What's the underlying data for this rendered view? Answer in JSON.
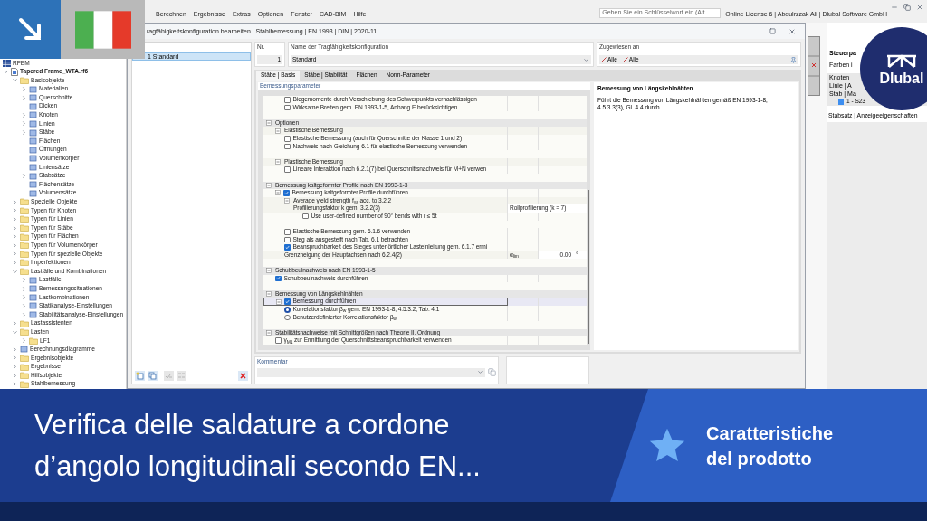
{
  "menu": {
    "items": [
      "Berechnen",
      "Ergebnisse",
      "Extras",
      "Optionen",
      "Fenster",
      "CAD-BIM",
      "Hilfe"
    ]
  },
  "search": {
    "placeholder": "Geben Sie ein Schlüsselwort ein (Alt..."
  },
  "license": "Online License 6 | Abdulrzzak Ali | Dlubal Software GmbH",
  "navigator": {
    "items": [
      {
        "label": "RFEM",
        "kind": "root"
      },
      {
        "label": "Tapered Frame_WTA.rf6",
        "kind": "file",
        "expanded": true,
        "children": [
          {
            "label": "Basisobjekte",
            "kind": "folder",
            "expanded": true,
            "children": [
              {
                "label": "Materialien",
                "kind": "item",
                "expanded": false
              },
              {
                "label": "Querschnitte",
                "kind": "item",
                "expanded": false
              },
              {
                "label": "Dicken",
                "kind": "item"
              },
              {
                "label": "Knoten",
                "kind": "item",
                "expanded": false
              },
              {
                "label": "Linien",
                "kind": "item",
                "expanded": false
              },
              {
                "label": "Stäbe",
                "kind": "item",
                "expanded": false
              },
              {
                "label": "Flächen",
                "kind": "item"
              },
              {
                "label": "Öffnungen",
                "kind": "item"
              },
              {
                "label": "Volumenkörper",
                "kind": "item"
              },
              {
                "label": "Liniensätze",
                "kind": "item"
              },
              {
                "label": "Stabsätze",
                "kind": "item",
                "expanded": false
              },
              {
                "label": "Flächensätze",
                "kind": "item"
              },
              {
                "label": "Volumensätze",
                "kind": "item"
              }
            ]
          },
          {
            "label": "Spezielle Objekte",
            "kind": "folder",
            "expanded": false
          },
          {
            "label": "Typen für Knoten",
            "kind": "folder",
            "expanded": false
          },
          {
            "label": "Typen für Linien",
            "kind": "folder",
            "expanded": false
          },
          {
            "label": "Typen für Stäbe",
            "kind": "folder",
            "expanded": false
          },
          {
            "label": "Typen für Flächen",
            "kind": "folder",
            "expanded": false
          },
          {
            "label": "Typen für Volumenkörper",
            "kind": "folder",
            "expanded": false
          },
          {
            "label": "Typen für spezielle Objekte",
            "kind": "folder",
            "expanded": false
          },
          {
            "label": "Imperfektionen",
            "kind": "folder",
            "expanded": false
          },
          {
            "label": "Lastfälle und Kombinationen",
            "kind": "folder",
            "expanded": true,
            "children": [
              {
                "label": "Lastfälle",
                "kind": "item",
                "expanded": false
              },
              {
                "label": "Bemessungssituationen",
                "kind": "item",
                "expanded": false
              },
              {
                "label": "Lastkombinationen",
                "kind": "item",
                "expanded": false
              },
              {
                "label": "Statikanalyse-Einstellungen",
                "kind": "item",
                "expanded": false
              },
              {
                "label": "Stabilitätsanalyse-Einstellungen",
                "kind": "item",
                "expanded": false
              }
            ]
          },
          {
            "label": "Lastassistenten",
            "kind": "folder",
            "expanded": false
          },
          {
            "label": "Lasten",
            "kind": "folder",
            "expanded": true,
            "children": [
              {
                "label": "LF1",
                "kind": "folder",
                "expanded": false
              }
            ]
          },
          {
            "label": "Berechnungsdiagramme",
            "kind": "item",
            "expanded": false
          },
          {
            "label": "Ergebnisobjekte",
            "kind": "folder",
            "expanded": false
          },
          {
            "label": "Ergebnisse",
            "kind": "folder",
            "expanded": false
          },
          {
            "label": "Hilfsobjekte",
            "kind": "folder",
            "expanded": false
          },
          {
            "label": "Stahlbemessung",
            "kind": "folder",
            "expanded": false
          }
        ]
      }
    ]
  },
  "dialog": {
    "title": "ragfähigkeitskonfiguration bearbeiten | Stahlbemessung | EN 1993 | DIN | 2020-11",
    "list": {
      "items": [
        {
          "number": "1",
          "label": "Standard",
          "selected": true
        }
      ]
    },
    "nr": {
      "label": "Nr.",
      "value": "1"
    },
    "name": {
      "label": "Name der Tragfähigkeitskonfiguration",
      "value": "Standard"
    },
    "assigned": {
      "label": "Zugewiesen an",
      "items": [
        "Alle",
        "Alle"
      ]
    },
    "tabs": [
      {
        "label": "Stäbe | Basis",
        "selected": true
      },
      {
        "label": "Stäbe | Stabilität",
        "selected": false
      },
      {
        "label": "Flächen",
        "selected": false
      },
      {
        "label": "Norm-Parameter",
        "selected": false
      }
    ],
    "parameters": {
      "title": "Bemessungsparameter",
      "rows": [
        {
          "kind": "continued",
          "children": [
            {
              "kind": "check",
              "label": "Biegemomente durch Verschiebung des Schwerpunkts vernachlässigen",
              "checked": false
            },
            {
              "kind": "check",
              "label": "Wirksame Breiten gem. EN 1993-1-5, Anhang E berücksichtigen",
              "checked": false
            },
            {
              "kind": "spacer"
            }
          ]
        },
        {
          "kind": "section",
          "label": "Optionen",
          "children": [
            {
              "kind": "group",
              "label": "Elastische Bemessung",
              "children": [
                {
                  "kind": "check",
                  "label": "Elastische Bemessung (auch für Querschnitte der Klasse 1 und 2)",
                  "checked": false
                },
                {
                  "kind": "check",
                  "label": "Nachweis nach Gleichung 6.1 für elastische Bemessung verwenden",
                  "checked": false
                }
              ]
            },
            {
              "kind": "spacer"
            },
            {
              "kind": "group",
              "label": "Plastische Bemessung",
              "children": [
                {
                  "kind": "check",
                  "label": "Lineare Interaktion nach 6.2.1(7) bei Querschnittsnachweis für M+N verwen",
                  "checked": false
                }
              ]
            },
            {
              "kind": "spacer"
            }
          ]
        },
        {
          "kind": "section",
          "label": "Bemessung kaltgeformter Profile nach EN 1993-1-3",
          "children": [
            {
              "kind": "check",
              "label": "Bemessung kaltgeformter Profile durchführen",
              "checked": true,
              "children": [
                {
                  "kind": "group",
                  "label": "Average yield strength f$_{ya}$ acc. to 3.2.2",
                  "children": [
                    {
                      "kind": "field",
                      "label": "Profilierungsfaktor k gem. 3.2.2(3)",
                      "value": "Rollprofilierung (k = 7)",
                      "children": [
                        {
                          "kind": "check",
                          "label": "Use user-defined number of 90° bends with r ≤ 5t",
                          "checked": false
                        }
                      ]
                    }
                  ]
                },
                {
                  "kind": "spacer"
                },
                {
                  "kind": "check",
                  "label": "Elastische Bemessung gem. 6.1.6 verwenden",
                  "checked": false
                },
                {
                  "kind": "check",
                  "label": "Steg als ausgesteift nach Tab. 6.1 betrachten",
                  "checked": false
                },
                {
                  "kind": "check",
                  "label": "Beanspruchbarkeit des Steges unter örtlicher Lasteinleitung gem. 6.1.7 ermi",
                  "checked": true
                },
                {
                  "kind": "field",
                  "label": "Grenzneigung der Hauptachsen nach 6.2.4(2)",
                  "symbol": "α$_{lim}$",
                  "value": "0.00",
                  "unit": "°"
                }
              ]
            },
            {
              "kind": "spacer"
            }
          ]
        },
        {
          "kind": "section",
          "label": "Schubbeulnachweis nach EN 1993-1-5",
          "children": [
            {
              "kind": "check",
              "label": "Schubbeulnachweis durchführen",
              "checked": true
            },
            {
              "kind": "spacer"
            }
          ]
        },
        {
          "kind": "section",
          "label": "Bemessung von Längskehlnähten",
          "children": [
            {
              "kind": "check",
              "label": "Bemessung durchführen",
              "checked": true,
              "focused": true,
              "children": [
                {
                  "kind": "radio",
                  "label": "Korrelationsfaktor β$_{w}$ gem. EN 1993-1-8, 4.5.3.2, Tab. 4.1",
                  "selected": true
                },
                {
                  "kind": "radio",
                  "label": "Benutzerdefinierter Korrelationsfaktor β$_{w}$",
                  "selected": false
                }
              ]
            },
            {
              "kind": "spacer"
            }
          ]
        },
        {
          "kind": "section",
          "label": "Stabilitätsnachweise mit Schnittgrößen nach Theorie II. Ordnung",
          "children": [
            {
              "kind": "check",
              "label": "γ$_{M1}$ zur Ermittlung der Querschnittsbeanspruchbarkeit verwenden",
              "checked": false
            }
          ]
        }
      ]
    },
    "description": {
      "title": "Bemessung von Längskehlnähten",
      "text": "Führt die Bemessung von Längskehlnähten gemäß EN 1993-1-8, 4.5.3.3(3), Gl. 4.4 durch."
    },
    "comment": {
      "label": "Kommentar"
    }
  },
  "control_panel": {
    "title": "Steuerpa",
    "subtitle": "Farben i",
    "rows": [
      "Knoten",
      "Linie | A",
      "Stab | Ma"
    ],
    "member": {
      "label": "1 - S23",
      "color": "#3d8ef0"
    },
    "footer": "Stabsatz | Anzeigeeigenschaften"
  },
  "logo": {
    "text": "Dlubal"
  },
  "banner": {
    "lines": [
      "Verifica delle saldature a cordone",
      "d’angolo longitudinali secondo EN..."
    ],
    "tag": [
      "Caratteristiche",
      "del prodotto"
    ]
  }
}
